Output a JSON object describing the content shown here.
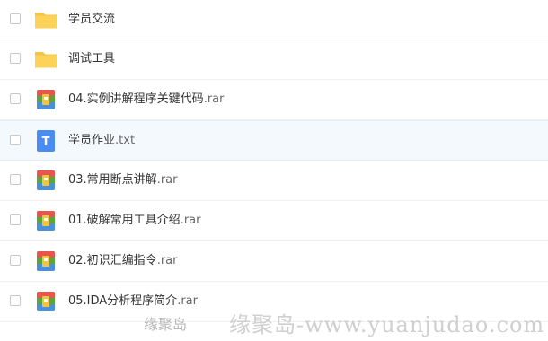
{
  "files": [
    {
      "name": "学员交流",
      "ext": "",
      "type": "folder"
    },
    {
      "name": "调试工具",
      "ext": "",
      "type": "folder"
    },
    {
      "name": "04.实例讲解程序关键代码",
      "ext": ".rar",
      "type": "archive"
    },
    {
      "name": "学员作业",
      "ext": ".txt",
      "type": "text",
      "icon_letter": "T"
    },
    {
      "name": "03.常用断点讲解",
      "ext": ".rar",
      "type": "archive"
    },
    {
      "name": "01.破解常用工具介绍",
      "ext": ".rar",
      "type": "archive"
    },
    {
      "name": "02.初识汇编指令",
      "ext": ".rar",
      "type": "archive"
    },
    {
      "name": "05.IDA分析程序简介",
      "ext": ".rar",
      "type": "archive"
    }
  ],
  "watermark": {
    "small": "缘聚岛",
    "large": "缘聚岛-www.yuanjudao.com"
  },
  "colors": {
    "folder": "#fcd258",
    "text_icon": "#4b8cf0",
    "highlight_row": "#f4f9fe"
  }
}
